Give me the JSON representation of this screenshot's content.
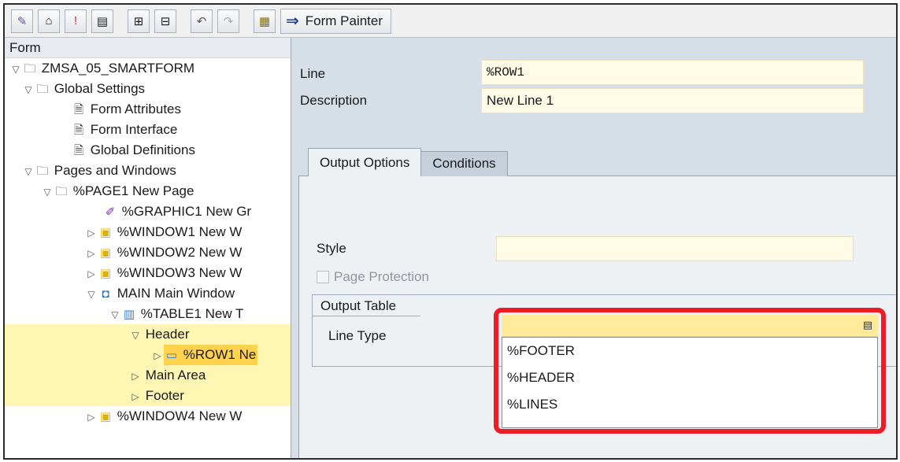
{
  "toolbar": {
    "icons": [
      "edit-icon",
      "hierarchy-icon",
      "flag-icon",
      "layout-icon",
      "expand-icon",
      "collapse-icon",
      "undo-icon",
      "redo-icon",
      "form-painter-icon"
    ],
    "form_painter_label": "Form Painter",
    "arrow": "⇒"
  },
  "tree": {
    "header": "Form",
    "nodes": [
      {
        "label": "ZMSA_05_SMARTFORM",
        "toggle": "▽",
        "icon": "folder-icon"
      },
      {
        "label": "Global Settings",
        "toggle": "▽",
        "icon": "folder-icon"
      },
      {
        "label": "Form Attributes",
        "toggle": "",
        "icon": "document-icon"
      },
      {
        "label": "Form Interface",
        "toggle": "",
        "icon": "document-icon"
      },
      {
        "label": "Global Definitions",
        "toggle": "",
        "icon": "document-icon"
      },
      {
        "label": "Pages and Windows",
        "toggle": "▽",
        "icon": "folder-icon"
      },
      {
        "label": "%PAGE1 New Page",
        "toggle": "▽",
        "icon": "folder-icon"
      },
      {
        "label": "%GRAPHIC1 New Gr",
        "toggle": "",
        "icon": "graphic-icon"
      },
      {
        "label": "%WINDOW1 New W",
        "toggle": "▷",
        "icon": "window-icon"
      },
      {
        "label": "%WINDOW2 New W",
        "toggle": "▷",
        "icon": "window-icon"
      },
      {
        "label": "%WINDOW3 New W",
        "toggle": "▷",
        "icon": "window-icon"
      },
      {
        "label": "MAIN Main Window",
        "toggle": "▽",
        "icon": "main-window-icon"
      },
      {
        "label": "%TABLE1 New T",
        "toggle": "▽",
        "icon": "table-icon"
      },
      {
        "label": "Header",
        "toggle": "▽",
        "icon": ""
      },
      {
        "label": "%ROW1 Ne",
        "toggle": "▷",
        "icon": "row-icon"
      },
      {
        "label": "Main Area",
        "toggle": "▷",
        "icon": ""
      },
      {
        "label": "Footer",
        "toggle": "▷",
        "icon": ""
      },
      {
        "label": "%WINDOW4 New W",
        "toggle": "▷",
        "icon": "window-icon"
      }
    ]
  },
  "details": {
    "line_label": "Line",
    "line_value": "%ROW1",
    "description_label": "Description",
    "description_value": "New Line 1"
  },
  "tabs": {
    "output_options": "Output Options",
    "conditions": "Conditions"
  },
  "output_options": {
    "style_label": "Style",
    "style_value": "",
    "page_protection_label": "Page Protection",
    "page_protection_checked": false
  },
  "output_table": {
    "group_label": "Output Table",
    "line_type_label": "Line Type",
    "line_type_value": "",
    "dropdown_options": [
      "%FOOTER",
      "%HEADER",
      "%LINES"
    ]
  },
  "colors": {
    "highlight_border": "#ee1c25",
    "selected_node": "#ffd24d",
    "hl_node": "#fff6b3"
  }
}
